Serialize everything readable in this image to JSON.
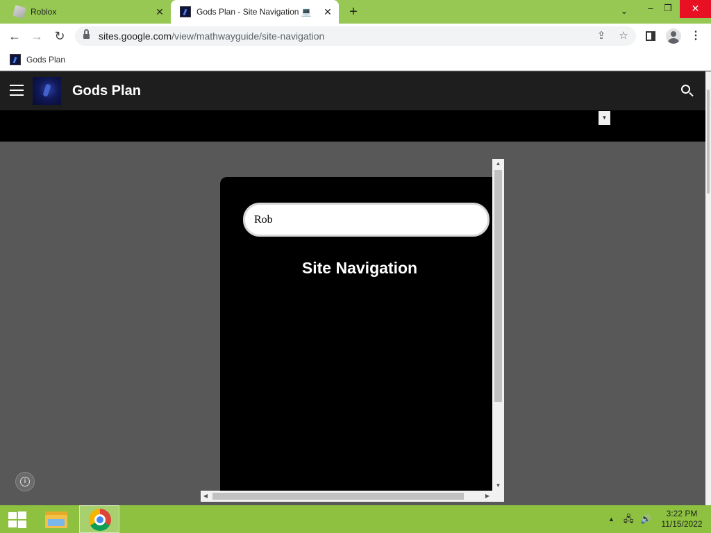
{
  "browser": {
    "tabs": [
      {
        "title": "Roblox",
        "active": false
      },
      {
        "title": "Gods Plan - Site Navigation 💻",
        "active": true
      }
    ],
    "url_host": "sites.google.com",
    "url_path": "/view/mathwayguide/site-navigation",
    "bookmarks": [
      {
        "label": "Gods Plan"
      }
    ]
  },
  "site": {
    "title": "Gods Plan"
  },
  "embed": {
    "search_value": "Rob",
    "heading": "Site Navigation"
  },
  "taskbar": {
    "time": "3:22 PM",
    "date": "11/15/2022"
  },
  "colors": {
    "tabstrip": "#97c853",
    "taskbar": "#8dc13f",
    "site_header": "#1e1e1e",
    "content_bg": "#585858",
    "close_button": "#e81123"
  }
}
